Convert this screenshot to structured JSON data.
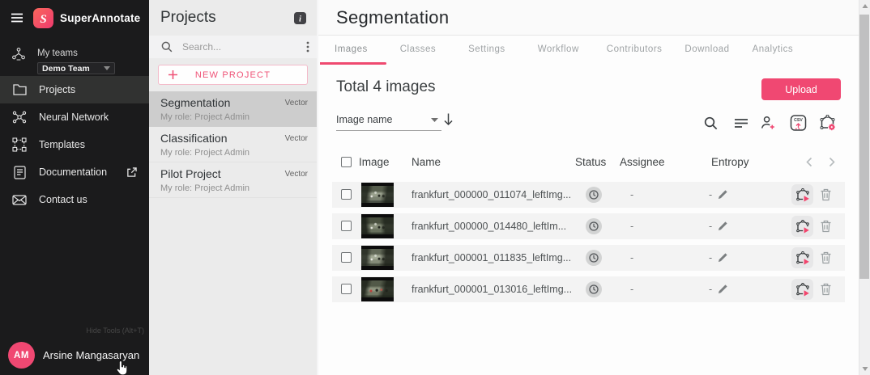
{
  "colors": {
    "accent": "#f04872"
  },
  "sidebar": {
    "brand": "SuperAnnotate",
    "teams_label": "My teams",
    "team_selected": "Demo Team",
    "nav": [
      {
        "label": "Projects",
        "icon": "folder",
        "active": true
      },
      {
        "label": "Neural Network",
        "icon": "neural",
        "active": false
      },
      {
        "label": "Templates",
        "icon": "templates",
        "active": false
      },
      {
        "label": "Documentation",
        "icon": "document",
        "active": false,
        "external": true
      },
      {
        "label": "Contact us",
        "icon": "envelope",
        "active": false
      }
    ],
    "hide_tools_tooltip": "Hide Tools (Alt+T)",
    "user": {
      "initials": "AM",
      "name": "Arsine Mangasaryan"
    }
  },
  "projects_panel": {
    "title": "Projects",
    "search_placeholder": "Search...",
    "new_project_label": "NEW PROJECT",
    "items": [
      {
        "name": "Segmentation",
        "type": "Vector",
        "role": "My role: Project Admin",
        "selected": true
      },
      {
        "name": "Classification",
        "type": "Vector",
        "role": "My role: Project Admin",
        "selected": false
      },
      {
        "name": "Pilot Project",
        "type": "Vector",
        "role": "My role: Project Admin",
        "selected": false
      }
    ]
  },
  "main": {
    "title": "Segmentation",
    "tabs": [
      {
        "label": "Images",
        "active": true
      },
      {
        "label": "Classes",
        "active": false
      },
      {
        "label": "Settings",
        "active": false
      },
      {
        "label": "Workflow",
        "active": false
      },
      {
        "label": "Contributors",
        "active": false
      },
      {
        "label": "Download",
        "active": false
      },
      {
        "label": "Analytics",
        "active": false
      }
    ],
    "total_label": "Total 4 images",
    "upload_label": "Upload",
    "sort_field": "Image name",
    "table": {
      "columns": [
        "Image",
        "Name",
        "Status",
        "Assignee",
        "Entropy"
      ],
      "rows": [
        {
          "name": "frankfurt_000000_011074_leftImg...",
          "status": "pending",
          "assignee": "-",
          "entropy": "-"
        },
        {
          "name": "frankfurt_000000_014480_leftIm...",
          "status": "pending",
          "assignee": "-",
          "entropy": "-"
        },
        {
          "name": "frankfurt_000001_011835_leftImg...",
          "status": "pending",
          "assignee": "-",
          "entropy": "-"
        },
        {
          "name": "frankfurt_000001_013016_leftImg...",
          "status": "pending",
          "assignee": "-",
          "entropy": "-"
        }
      ]
    }
  }
}
